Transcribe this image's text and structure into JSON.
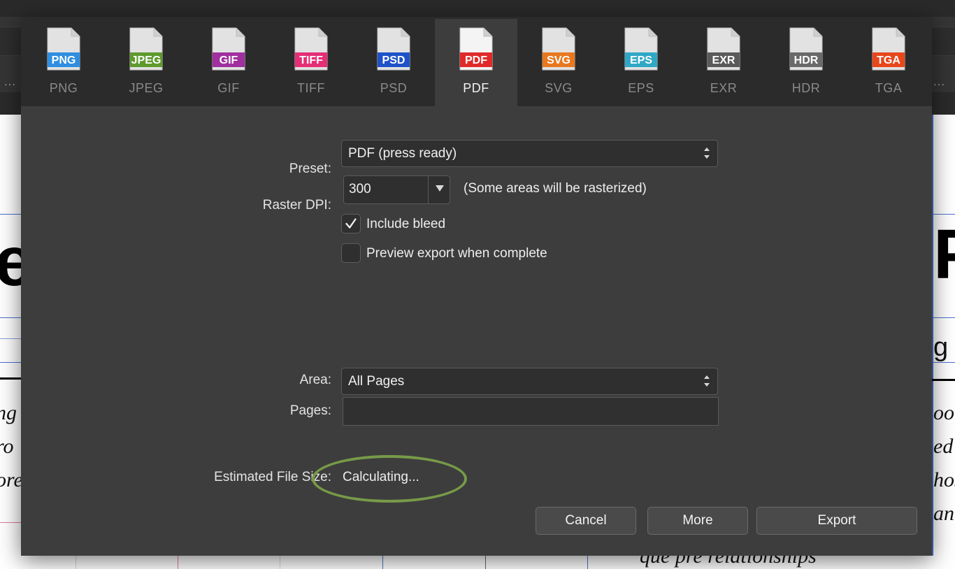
{
  "background": {
    "big_glyph_left": "e",
    "big_glyph_right": "P",
    "small_glyph_right": "g",
    "italic_left": [
      "ng",
      "ro",
      "ore"
    ],
    "italic_right": [
      "ool",
      "ed",
      "hos",
      "an"
    ],
    "italic_bottom": "que pre relationships"
  },
  "formats": [
    {
      "id": "png",
      "label": "PNG",
      "badge": "PNG",
      "color": "#2f8ee0"
    },
    {
      "id": "jpeg",
      "label": "JPEG",
      "badge": "JPEG",
      "color": "#5e9a2e"
    },
    {
      "id": "gif",
      "label": "GIF",
      "badge": "GIF",
      "color": "#a02f9f"
    },
    {
      "id": "tiff",
      "label": "TIFF",
      "badge": "TIFF",
      "color": "#e52e76"
    },
    {
      "id": "psd",
      "label": "PSD",
      "badge": "PSD",
      "color": "#1f52c9"
    },
    {
      "id": "pdf",
      "label": "PDF",
      "badge": "PDF",
      "color": "#e02a2a",
      "selected": true
    },
    {
      "id": "svg",
      "label": "SVG",
      "badge": "SVG",
      "color": "#e9781f"
    },
    {
      "id": "eps",
      "label": "EPS",
      "badge": "EPS",
      "color": "#2fa8c6"
    },
    {
      "id": "exr",
      "label": "EXR",
      "badge": "EXR",
      "color": "#5a5a5a"
    },
    {
      "id": "hdr",
      "label": "HDR",
      "badge": "HDR",
      "color": "#6a6a6a"
    },
    {
      "id": "tga",
      "label": "TGA",
      "badge": "TGA",
      "color": "#e8471c"
    }
  ],
  "settings": {
    "preset_label": "Preset:",
    "preset_value": "PDF (press ready)",
    "raster_dpi_label": "Raster DPI:",
    "raster_dpi_value": "300",
    "raster_note": "(Some areas will be rasterized)",
    "include_bleed_label": "Include bleed",
    "include_bleed_checked": true,
    "preview_export_label": "Preview export when complete",
    "preview_export_checked": false,
    "area_label": "Area:",
    "area_value": "All Pages",
    "pages_label": "Pages:",
    "pages_value": "",
    "file_size_label": "Estimated File Size:",
    "file_size_value": "Calculating..."
  },
  "buttons": {
    "cancel": "Cancel",
    "more": "More",
    "export": "Export"
  },
  "colors": {
    "dialog_bg": "#3d3d3d",
    "tab_bar_bg": "#2b2b2b",
    "annotation": "#779a48"
  }
}
